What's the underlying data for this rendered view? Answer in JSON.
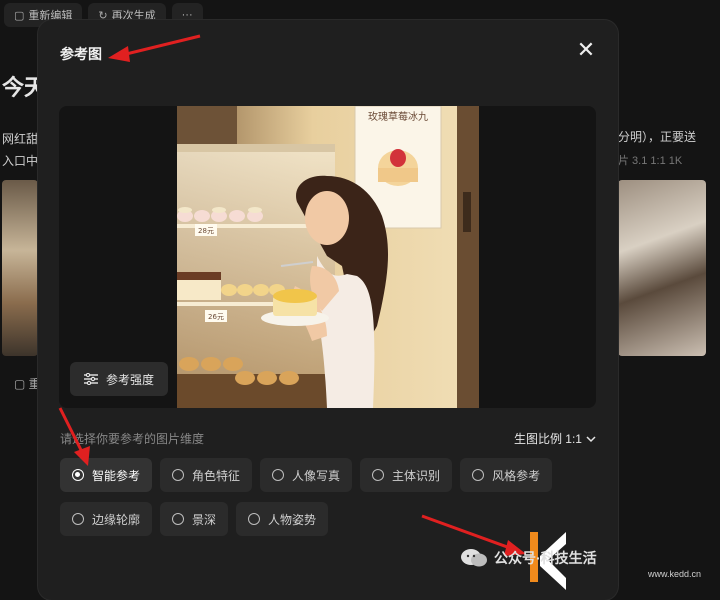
{
  "background": {
    "toolbar": [
      {
        "icon": "edit-icon",
        "label": "重新编辑"
      },
      {
        "icon": "refresh-icon",
        "label": "再次生成"
      },
      {
        "icon": "more-icon",
        "label": "···"
      }
    ],
    "title": "今天",
    "desc_left_1": "网红甜",
    "desc_left_2": "入口中",
    "desc_right": "分明），正要送",
    "meta_right": "片 3.1  1:1  1K",
    "bottom_left": "重"
  },
  "modal": {
    "title": "参考图",
    "close_label": "✕",
    "strength_label": "参考强度",
    "hint": "请选择你要参考的图片维度",
    "ratio_label": "生图比例 1:1",
    "options_row1": [
      {
        "label": "智能参考",
        "selected": true
      },
      {
        "label": "角色特征",
        "selected": false
      },
      {
        "label": "人像写真",
        "selected": false
      },
      {
        "label": "主体识别",
        "selected": false
      },
      {
        "label": "风格参考",
        "selected": false
      }
    ],
    "options_row2": [
      {
        "label": "边缘轮廓",
        "selected": false
      },
      {
        "label": "景深",
        "selected": false
      },
      {
        "label": "人物姿势",
        "selected": false
      }
    ],
    "poster_text": "玫瑰草莓冰九",
    "price_tags": [
      "28元",
      "26元"
    ]
  },
  "watermark": {
    "text": "公众号·科技生活",
    "url": "www.kedd.cn"
  },
  "colors": {
    "arrow": "#e02020",
    "modal_bg": "#1f1f1f",
    "chip_bg": "#2b2b2b"
  }
}
